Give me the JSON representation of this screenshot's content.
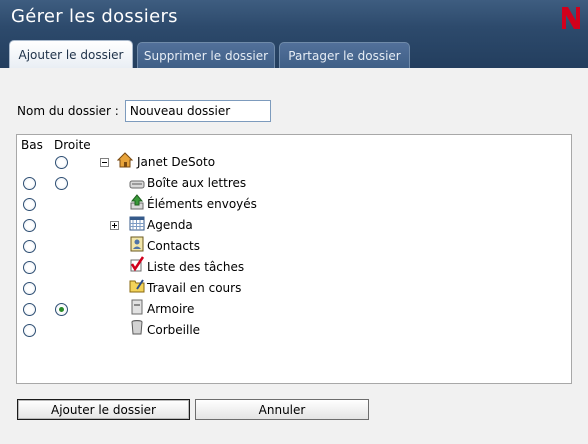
{
  "window": {
    "title": "Gérer les dossiers",
    "logo_icon": "novell-n-logo"
  },
  "tabs": [
    {
      "label": "Ajouter le dossier",
      "active": true
    },
    {
      "label": "Supprimer le dossier",
      "active": false
    },
    {
      "label": "Partager le dossier",
      "active": false
    }
  ],
  "form": {
    "name_label": "Nom du dossier :",
    "name_value": "Nouveau dossier"
  },
  "tree": {
    "col_bas": "Bas",
    "col_droite": "Droite",
    "root": {
      "label": "Janet DeSoto",
      "icon": "home-icon",
      "expanded": true,
      "bas_radio": false,
      "droite_radio": true
    },
    "items": [
      {
        "label": "Boîte aux lettres",
        "icon": "mailbox-icon",
        "droite_radio": true,
        "expander": false
      },
      {
        "label": "Éléments envoyés",
        "icon": "sent-items-icon",
        "droite_radio": false,
        "expander": false
      },
      {
        "label": "Agenda",
        "icon": "calendar-icon",
        "droite_radio": false,
        "expander": "plus"
      },
      {
        "label": "Contacts",
        "icon": "contacts-icon",
        "droite_radio": false,
        "expander": false
      },
      {
        "label": "Liste des tâches",
        "icon": "task-checkmark-icon",
        "droite_radio": false,
        "expander": false
      },
      {
        "label": "Travail en cours",
        "icon": "work-in-progress-icon",
        "droite_radio": false,
        "expander": false
      },
      {
        "label": "Armoire",
        "icon": "cabinet-icon",
        "droite_radio": true,
        "droite_checked": true,
        "expander": false
      },
      {
        "label": "Corbeille",
        "icon": "trash-icon",
        "droite_radio": false,
        "expander": false
      }
    ]
  },
  "buttons": {
    "add_label": "Ajouter le dossier",
    "cancel_label": "Annuler"
  },
  "colors": {
    "titlebar": "#2d4a6c",
    "logo_red": "#d1001c",
    "selected_radio": "#2a8a2a"
  }
}
